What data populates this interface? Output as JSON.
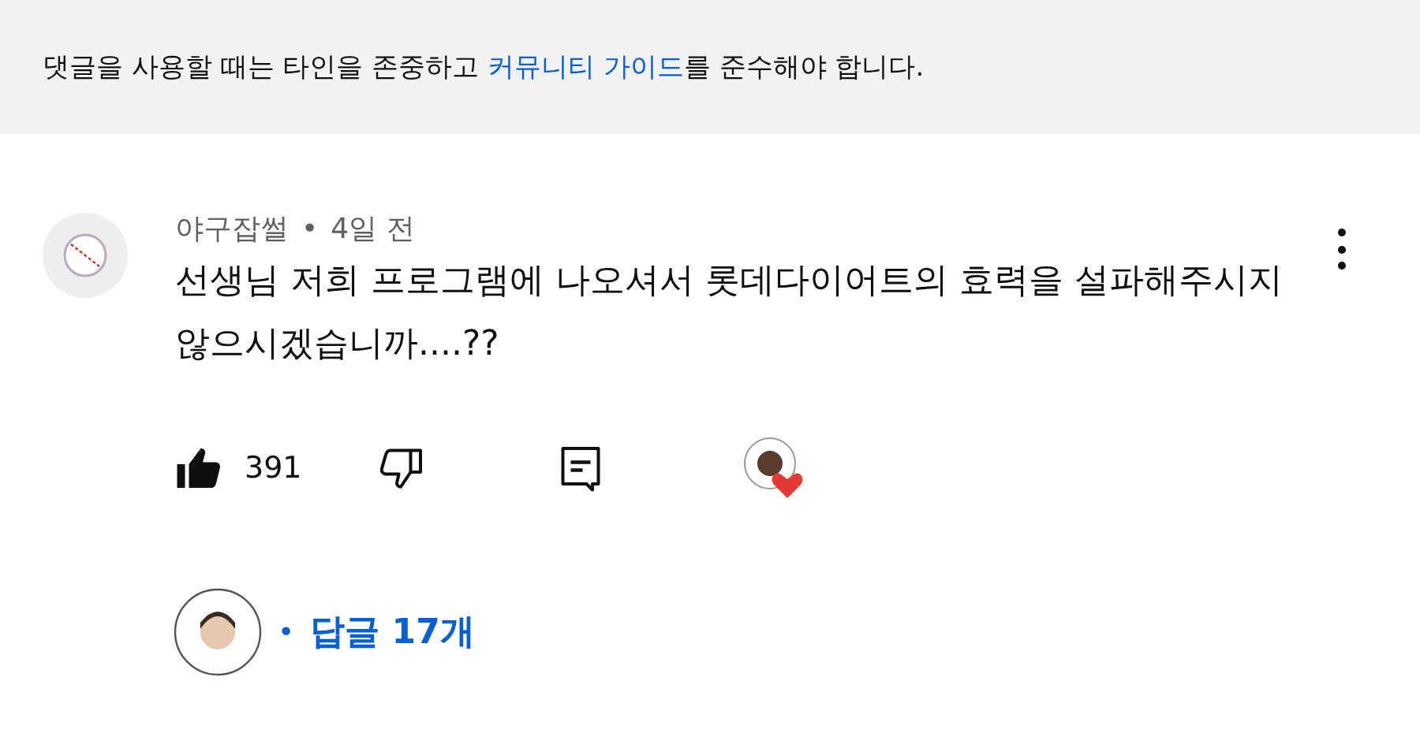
{
  "notice": {
    "text_before": "댓글을 사용할 때는 타인을 존중하고 ",
    "link": "커뮤니티 가이드",
    "text_after": "를 준수해야 합니다."
  },
  "comment": {
    "author": "야구잡썰",
    "separator": "•",
    "time": "4일 전",
    "body": "선생님 저희 프로그램에 나오셔서 롯데다이어트의 효력을 설파해주시지 않으시겠습니까....??",
    "likes": "391",
    "creator_hearted": true
  },
  "replies": {
    "separator": "•",
    "label": "답글 17개"
  }
}
